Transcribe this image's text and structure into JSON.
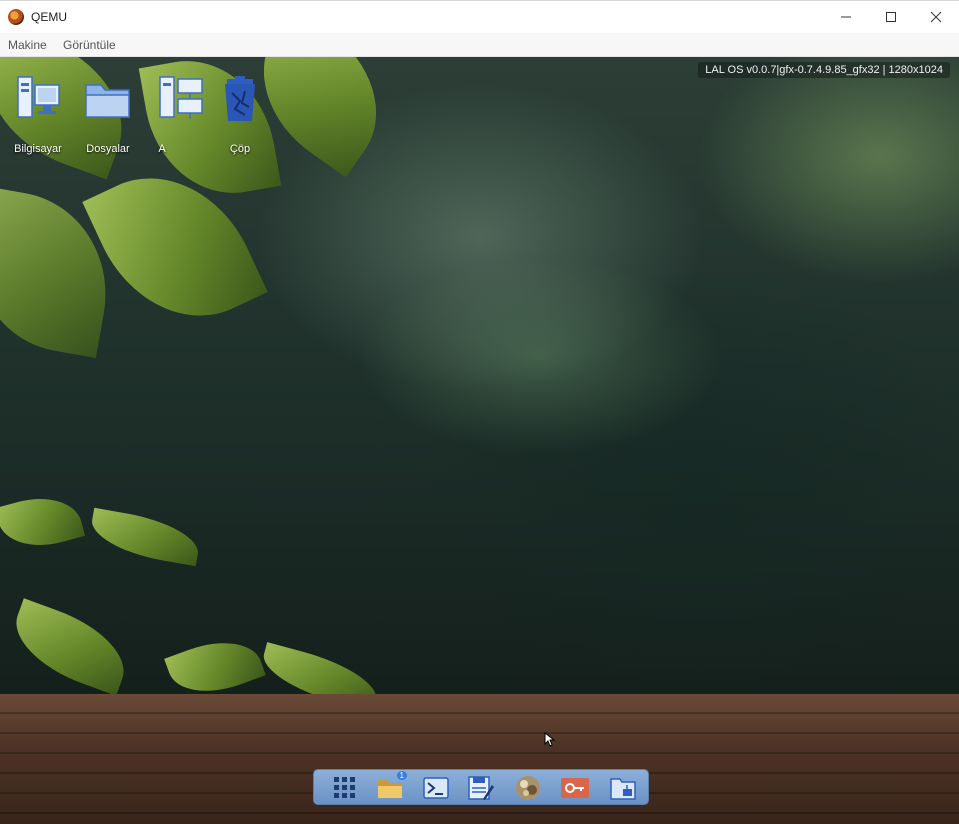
{
  "window": {
    "title": "QEMU",
    "min_icon": "minimize-icon",
    "max_icon": "maximize-icon",
    "close_icon": "close-icon"
  },
  "menubar": {
    "items": [
      "Makine",
      "Görüntüle"
    ]
  },
  "desktop": {
    "info": "LAL OS v0.0.7|gfx-0.7.4.9.85_gfx32 | 1280x1024",
    "icons": [
      {
        "label": "Bilgisayar",
        "icon": "computer-icon"
      },
      {
        "label": "Dosyalar",
        "icon": "folder-icon"
      },
      {
        "label": "A",
        "icon": "network-icon"
      },
      {
        "label": "Çöp",
        "icon": "trash-icon"
      }
    ]
  },
  "taskbar": {
    "items": [
      {
        "icon": "app-grid-icon"
      },
      {
        "icon": "file-manager-icon",
        "badge": "1"
      },
      {
        "icon": "terminal-icon"
      },
      {
        "icon": "text-editor-icon"
      },
      {
        "icon": "image-viewer-icon"
      },
      {
        "icon": "settings-icon"
      },
      {
        "icon": "network-folder-icon"
      }
    ]
  },
  "colors": {
    "taskbar": "#7ea3d1",
    "icon_blue": "#3f6fc4"
  }
}
